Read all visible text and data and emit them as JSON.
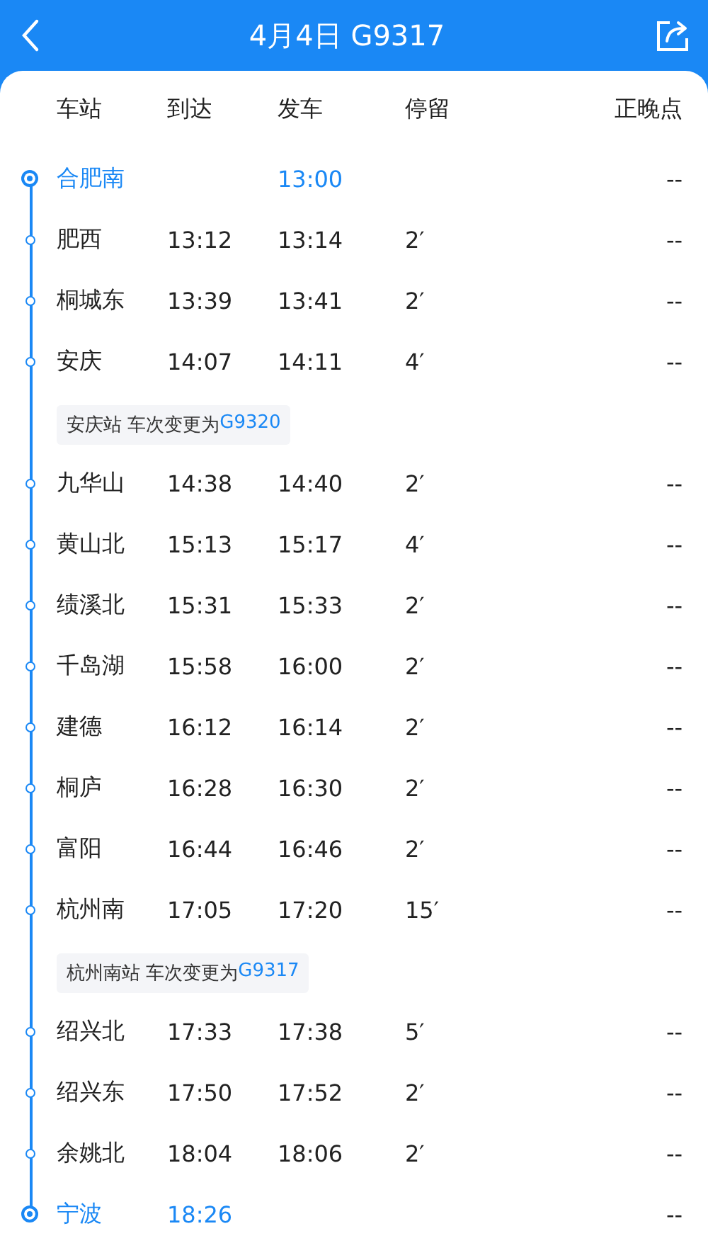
{
  "header": {
    "title": "4月4日 G9317"
  },
  "columns": [
    "车站",
    "到达",
    "发车",
    "停留",
    "正晚点"
  ],
  "stops": [
    {
      "kind": "station",
      "terminal": true,
      "name": "合肥南",
      "depart": "13:00",
      "status": "--"
    },
    {
      "kind": "station",
      "terminal": false,
      "name": "肥西",
      "arrive": "13:12",
      "depart": "13:14",
      "stay": "2′",
      "status": "--"
    },
    {
      "kind": "station",
      "terminal": false,
      "name": "桐城东",
      "arrive": "13:39",
      "depart": "13:41",
      "stay": "2′",
      "status": "--"
    },
    {
      "kind": "station",
      "terminal": false,
      "name": "安庆",
      "arrive": "14:07",
      "depart": "14:11",
      "stay": "4′",
      "status": "--"
    },
    {
      "kind": "note",
      "text": "安庆站 车次变更为",
      "train": "G9320"
    },
    {
      "kind": "station",
      "terminal": false,
      "name": "九华山",
      "arrive": "14:38",
      "depart": "14:40",
      "stay": "2′",
      "status": "--"
    },
    {
      "kind": "station",
      "terminal": false,
      "name": "黄山北",
      "arrive": "15:13",
      "depart": "15:17",
      "stay": "4′",
      "status": "--"
    },
    {
      "kind": "station",
      "terminal": false,
      "name": "绩溪北",
      "arrive": "15:31",
      "depart": "15:33",
      "stay": "2′",
      "status": "--"
    },
    {
      "kind": "station",
      "terminal": false,
      "name": "千岛湖",
      "arrive": "15:58",
      "depart": "16:00",
      "stay": "2′",
      "status": "--"
    },
    {
      "kind": "station",
      "terminal": false,
      "name": "建德",
      "arrive": "16:12",
      "depart": "16:14",
      "stay": "2′",
      "status": "--"
    },
    {
      "kind": "station",
      "terminal": false,
      "name": "桐庐",
      "arrive": "16:28",
      "depart": "16:30",
      "stay": "2′",
      "status": "--"
    },
    {
      "kind": "station",
      "terminal": false,
      "name": "富阳",
      "arrive": "16:44",
      "depart": "16:46",
      "stay": "2′",
      "status": "--"
    },
    {
      "kind": "station",
      "terminal": false,
      "name": "杭州南",
      "arrive": "17:05",
      "depart": "17:20",
      "stay": "15′",
      "status": "--"
    },
    {
      "kind": "note",
      "text": "杭州南站 车次变更为",
      "train": "G9317"
    },
    {
      "kind": "station",
      "terminal": false,
      "name": "绍兴北",
      "arrive": "17:33",
      "depart": "17:38",
      "stay": "5′",
      "status": "--"
    },
    {
      "kind": "station",
      "terminal": false,
      "name": "绍兴东",
      "arrive": "17:50",
      "depart": "17:52",
      "stay": "2′",
      "status": "--"
    },
    {
      "kind": "station",
      "terminal": false,
      "name": "余姚北",
      "arrive": "18:04",
      "depart": "18:06",
      "stay": "2′",
      "status": "--"
    },
    {
      "kind": "station",
      "terminal": true,
      "name": "宁波",
      "arrive": "18:26",
      "status": "--"
    }
  ]
}
